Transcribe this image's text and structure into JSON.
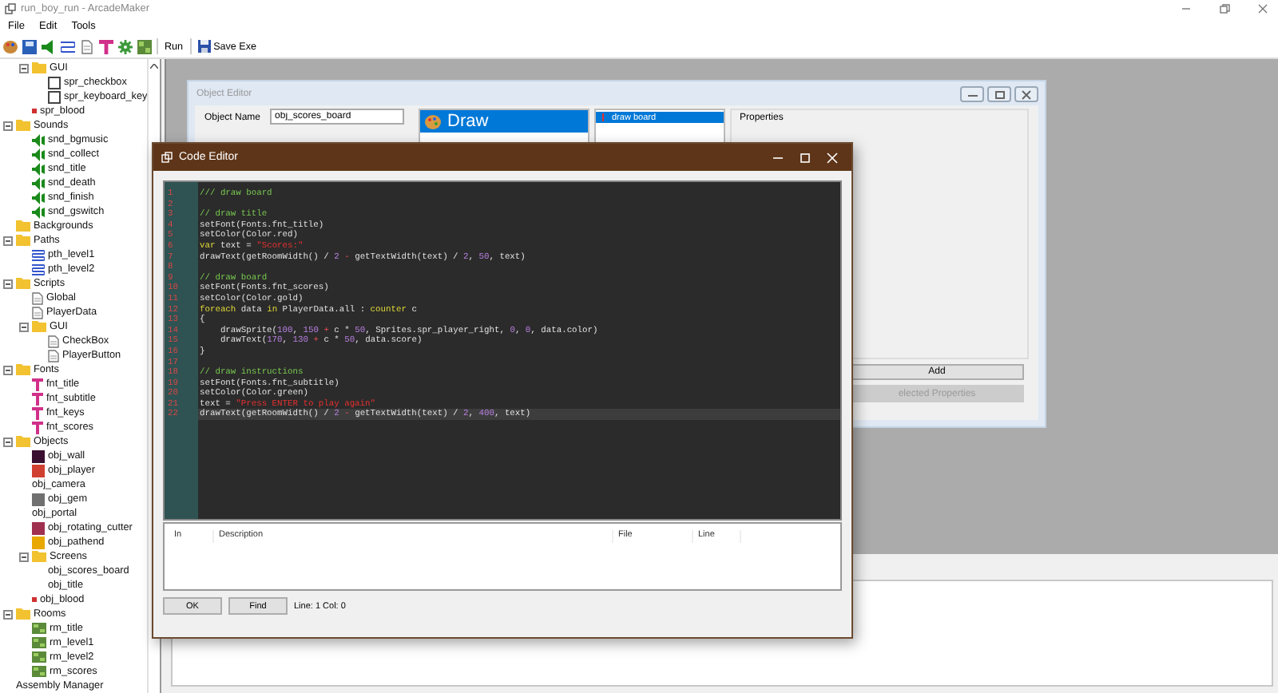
{
  "window": {
    "title": "run_boy_run - ArcadeMaker"
  },
  "menu": [
    "File",
    "Edit",
    "Tools"
  ],
  "toolbar": {
    "buttons": [
      {
        "label": "Run",
        "kind": "text"
      },
      {
        "label": "Save Exe",
        "kind": "save"
      }
    ]
  },
  "tree": {
    "continued": [
      {
        "label": "GUI",
        "kind": "folder",
        "expanded": true,
        "children": [
          {
            "label": "spr_checkbox",
            "kind": "sprite"
          },
          {
            "label": "spr_keyboard_key",
            "kind": "sprite"
          }
        ]
      },
      {
        "label": "spr_blood",
        "kind": "dot",
        "color": "#d03030"
      }
    ],
    "items": [
      {
        "label": "Sounds",
        "kind": "folder",
        "expanded": true,
        "children": [
          {
            "label": "snd_bgmusic",
            "kind": "sound"
          },
          {
            "label": "snd_collect",
            "kind": "sound"
          },
          {
            "label": "snd_title",
            "kind": "sound"
          },
          {
            "label": "snd_death",
            "kind": "sound"
          },
          {
            "label": "snd_finish",
            "kind": "sound"
          },
          {
            "label": "snd_gswitch",
            "kind": "sound"
          }
        ]
      },
      {
        "label": "Backgrounds",
        "kind": "folder"
      },
      {
        "label": "Paths",
        "kind": "folder",
        "expanded": true,
        "children": [
          {
            "label": "pth_level1",
            "kind": "path"
          },
          {
            "label": "pth_level2",
            "kind": "path"
          }
        ]
      },
      {
        "label": "Scripts",
        "kind": "folder",
        "expanded": true,
        "children": [
          {
            "label": "Global",
            "kind": "script"
          },
          {
            "label": "PlayerData",
            "kind": "script"
          },
          {
            "label": "GUI",
            "kind": "folder",
            "expanded": true,
            "children": [
              {
                "label": "CheckBox",
                "kind": "script"
              },
              {
                "label": "PlayerButton",
                "kind": "script"
              }
            ]
          }
        ]
      },
      {
        "label": "Fonts",
        "kind": "folder",
        "expanded": true,
        "children": [
          {
            "label": "fnt_title",
            "kind": "font"
          },
          {
            "label": "fnt_subtitle",
            "kind": "font"
          },
          {
            "label": "fnt_keys",
            "kind": "font"
          },
          {
            "label": "fnt_scores",
            "kind": "font"
          }
        ]
      },
      {
        "label": "Objects",
        "kind": "folder",
        "expanded": true,
        "children": [
          {
            "label": "obj_wall",
            "kind": "object",
            "color": "#3a1030"
          },
          {
            "label": "obj_player",
            "kind": "object",
            "color": "#d04030"
          },
          {
            "label": "obj_camera",
            "kind": "plain"
          },
          {
            "label": "obj_gem",
            "kind": "object",
            "color": "#707070"
          },
          {
            "label": "obj_portal",
            "kind": "plain"
          },
          {
            "label": "obj_rotating_cutter",
            "kind": "object",
            "color": "#a03050"
          },
          {
            "label": "obj_pathend",
            "kind": "object",
            "color": "#e8a800"
          },
          {
            "label": "Screens",
            "kind": "folder",
            "expanded": true,
            "children": [
              {
                "label": "obj_scores_board",
                "kind": "plain"
              },
              {
                "label": "obj_title",
                "kind": "plain"
              }
            ]
          },
          {
            "label": "obj_blood",
            "kind": "dot",
            "color": "#d03030"
          }
        ]
      },
      {
        "label": "Rooms",
        "kind": "folder",
        "expanded": true,
        "children": [
          {
            "label": "rm_title",
            "kind": "room"
          },
          {
            "label": "rm_level1",
            "kind": "room"
          },
          {
            "label": "rm_level2",
            "kind": "room"
          },
          {
            "label": "rm_scores",
            "kind": "room"
          }
        ]
      },
      {
        "label": "Assembly Manager",
        "kind": "plain"
      }
    ]
  },
  "object_editor": {
    "title": "Object Editor",
    "name_label": "Object Name",
    "name_value": "obj_scores_board",
    "events": [
      {
        "label": "Draw",
        "selected": true
      }
    ],
    "actions": [
      {
        "label": "draw board",
        "selected": true
      }
    ],
    "properties_label": "Properties",
    "buttons": [
      {
        "label": "Add",
        "disabled": false
      },
      {
        "label": "elected Properties",
        "disabled": true
      }
    ]
  },
  "code_editor": {
    "title": "Code Editor",
    "lines": [
      {
        "number": "1",
        "current": false,
        "tokens": [
          {
            "kind": "comment",
            "text": "/// draw board"
          }
        ]
      },
      {
        "number": "2",
        "current": false
      },
      {
        "number": "3",
        "current": false,
        "tokens": [
          {
            "kind": "comment",
            "text": "// draw title"
          }
        ]
      },
      {
        "number": "4",
        "current": false,
        "tokens": [
          {
            "kind": "plain",
            "text": "setFont(Fonts.fnt_title)"
          }
        ]
      },
      {
        "number": "5",
        "current": false,
        "tokens": [
          {
            "kind": "plain",
            "text": "setColor(Color.red)"
          }
        ]
      },
      {
        "number": "6",
        "current": false,
        "tokens": [
          {
            "kind": "keyword",
            "text": "var"
          },
          {
            "kind": "plain",
            "text": " text = "
          },
          {
            "kind": "string",
            "text": "\"Scores:\""
          }
        ]
      },
      {
        "number": "7",
        "current": false,
        "tokens": [
          {
            "kind": "plain",
            "text": "drawText(getRoomWidth() / "
          },
          {
            "kind": "number",
            "text": "2"
          },
          {
            "kind": "operator",
            "text": " - "
          },
          {
            "kind": "plain",
            "text": "getTextWidth(text) / "
          },
          {
            "kind": "number",
            "text": "2"
          },
          {
            "kind": "plain",
            "text": ", "
          },
          {
            "kind": "number",
            "text": "50"
          },
          {
            "kind": "plain",
            "text": ", text)"
          }
        ]
      },
      {
        "number": "8",
        "current": false
      },
      {
        "number": "9",
        "current": false,
        "tokens": [
          {
            "kind": "comment",
            "text": "// draw board"
          }
        ]
      },
      {
        "number": "10",
        "current": false,
        "tokens": [
          {
            "kind": "plain",
            "text": "setFont(Fonts.fnt_scores)"
          }
        ]
      },
      {
        "number": "11",
        "current": false,
        "tokens": [
          {
            "kind": "plain",
            "text": "setColor(Color.gold)"
          }
        ]
      },
      {
        "number": "12",
        "current": false,
        "tokens": [
          {
            "kind": "keyword",
            "text": "foreach"
          },
          {
            "kind": "plain",
            "text": " data "
          },
          {
            "kind": "keyword",
            "text": "in"
          },
          {
            "kind": "plain",
            "text": " PlayerData.all : "
          },
          {
            "kind": "keyword",
            "text": "counter"
          },
          {
            "kind": "plain",
            "text": " c"
          }
        ]
      },
      {
        "number": "13",
        "current": false,
        "tokens": [
          {
            "kind": "plain",
            "text": "{"
          }
        ]
      },
      {
        "number": "14",
        "current": false,
        "tokens": [
          {
            "kind": "plain",
            "text": "    drawSprite("
          },
          {
            "kind": "number",
            "text": "100"
          },
          {
            "kind": "plain",
            "text": ", "
          },
          {
            "kind": "number",
            "text": "150"
          },
          {
            "kind": "operator",
            "text": " + "
          },
          {
            "kind": "plain",
            "text": "c * "
          },
          {
            "kind": "number",
            "text": "50"
          },
          {
            "kind": "plain",
            "text": ", Sprites.spr_player_right, "
          },
          {
            "kind": "number",
            "text": "0"
          },
          {
            "kind": "plain",
            "text": ", "
          },
          {
            "kind": "number",
            "text": "0"
          },
          {
            "kind": "plain",
            "text": ", data.color)"
          }
        ]
      },
      {
        "number": "15",
        "current": false,
        "tokens": [
          {
            "kind": "plain",
            "text": "    drawText("
          },
          {
            "kind": "number",
            "text": "170"
          },
          {
            "kind": "plain",
            "text": ", "
          },
          {
            "kind": "number",
            "text": "130"
          },
          {
            "kind": "operator",
            "text": " + "
          },
          {
            "kind": "plain",
            "text": "c * "
          },
          {
            "kind": "number",
            "text": "50"
          },
          {
            "kind": "plain",
            "text": ", data.score)"
          }
        ]
      },
      {
        "number": "16",
        "current": false,
        "tokens": [
          {
            "kind": "plain",
            "text": "}"
          }
        ]
      },
      {
        "number": "17",
        "current": false
      },
      {
        "number": "18",
        "current": false,
        "tokens": [
          {
            "kind": "comment",
            "text": "// draw instructions"
          }
        ]
      },
      {
        "number": "19",
        "current": false,
        "tokens": [
          {
            "kind": "plain",
            "text": "setFont(Fonts.fnt_subtitle)"
          }
        ]
      },
      {
        "number": "20",
        "current": false,
        "tokens": [
          {
            "kind": "plain",
            "text": "setColor(Color.green)"
          }
        ]
      },
      {
        "number": "21",
        "current": false,
        "tokens": [
          {
            "kind": "plain",
            "text": "text = "
          },
          {
            "kind": "string",
            "text": "\"Press ENTER to play again\""
          }
        ]
      },
      {
        "number": "22",
        "current": true,
        "tokens": [
          {
            "kind": "plain",
            "text": "drawText(getRoomWidth() / "
          },
          {
            "kind": "number",
            "text": "2"
          },
          {
            "kind": "operator",
            "text": " - "
          },
          {
            "kind": "plain",
            "text": "getTextWidth(text) / "
          },
          {
            "kind": "number",
            "text": "2"
          },
          {
            "kind": "plain",
            "text": ", "
          },
          {
            "kind": "number",
            "text": "400"
          },
          {
            "kind": "plain",
            "text": ", text)"
          }
        ]
      }
    ],
    "error_columns": [
      "In",
      "Description",
      "File",
      "Line"
    ],
    "buttons": [
      "OK",
      "Find"
    ],
    "status": "Line: 1 Col: 0"
  }
}
